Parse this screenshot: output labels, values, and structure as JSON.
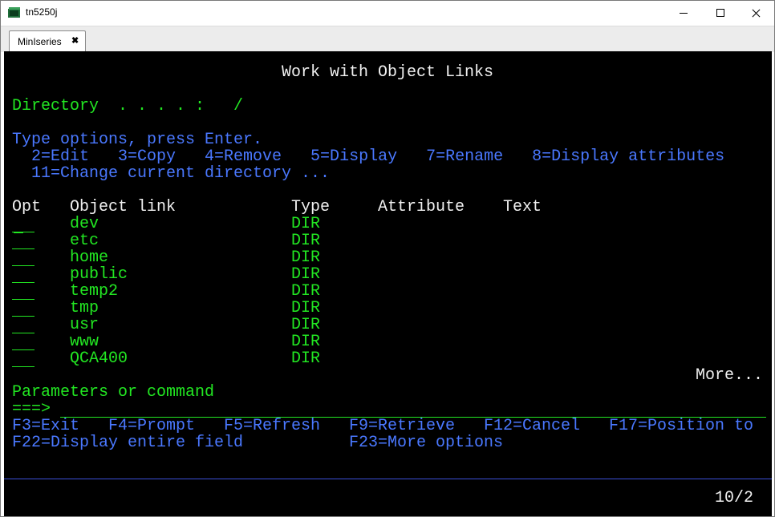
{
  "window": {
    "title": "tn5250j",
    "colors": {
      "terminal_bg": "#000000",
      "green": "#22e622",
      "blue": "#4a78ff",
      "white": "#f0f0f0"
    }
  },
  "tabs": [
    {
      "label": "MinIseries",
      "close": "✖"
    }
  ],
  "screen": {
    "title": "Work with Object Links",
    "directory_label": "Directory  . . . . :",
    "directory_value": "/",
    "instructions": "Type options, press Enter.",
    "options_line1": "2=Edit   3=Copy   4=Remove   5=Display   7=Rename   8=Display attributes",
    "options_line2": "11=Change current directory ...",
    "columns": {
      "opt": "Opt",
      "object_link": "Object link",
      "type": "Type",
      "attribute": "Attribute",
      "text": "Text"
    },
    "rows": [
      {
        "object_link": "dev",
        "type": "DIR"
      },
      {
        "object_link": "etc",
        "type": "DIR"
      },
      {
        "object_link": "home",
        "type": "DIR"
      },
      {
        "object_link": "public",
        "type": "DIR"
      },
      {
        "object_link": "temp2",
        "type": "DIR"
      },
      {
        "object_link": "tmp",
        "type": "DIR"
      },
      {
        "object_link": "usr",
        "type": "DIR"
      },
      {
        "object_link": "www",
        "type": "DIR"
      },
      {
        "object_link": "QCA400",
        "type": "DIR"
      }
    ],
    "more": "More...",
    "params_label": "Parameters or command",
    "prompt": "===>",
    "fkeys_line1": [
      "F3=Exit",
      "F4=Prompt",
      "F5=Refresh",
      "F9=Retrieve",
      "F12=Cancel",
      "F17=Position to"
    ],
    "fkeys_line2": [
      "F22=Display entire field",
      "F23=More options"
    ],
    "status_position": "10/2"
  }
}
